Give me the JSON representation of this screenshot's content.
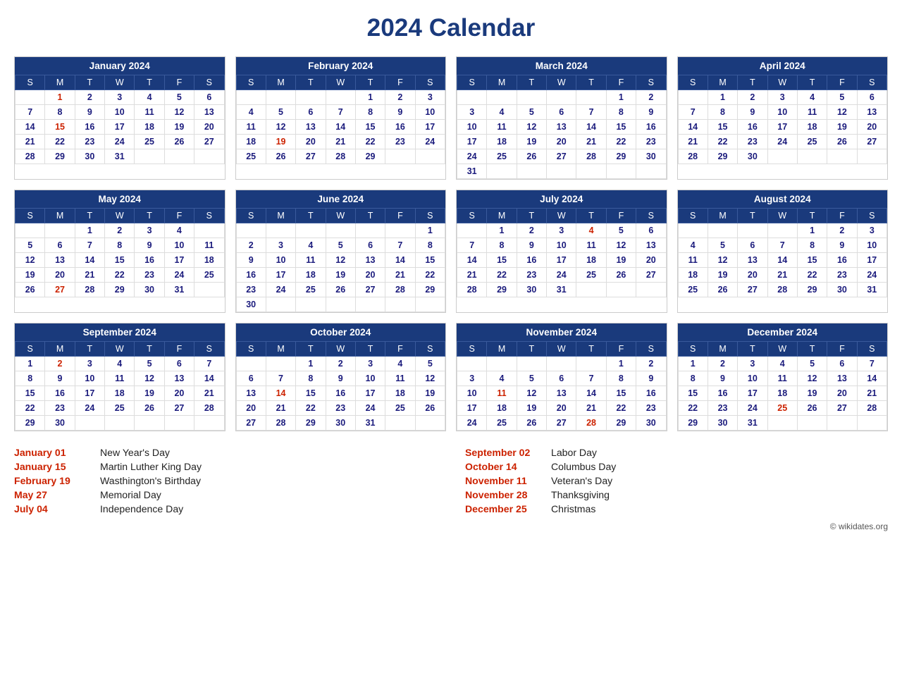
{
  "title": "2024 Calendar",
  "months": [
    {
      "name": "January 2024",
      "days_header": [
        "S",
        "M",
        "T",
        "W",
        "T",
        "F",
        "S"
      ],
      "weeks": [
        [
          "",
          "1h",
          "2",
          "3",
          "4",
          "5",
          "6"
        ],
        [
          "7",
          "8",
          "9",
          "10",
          "11",
          "12",
          "13"
        ],
        [
          "14",
          "15h",
          "16",
          "17",
          "18",
          "19",
          "20"
        ],
        [
          "21",
          "22",
          "23",
          "24",
          "25",
          "26",
          "27"
        ],
        [
          "28",
          "29",
          "30",
          "31",
          "",
          "",
          ""
        ]
      ]
    },
    {
      "name": "February 2024",
      "days_header": [
        "S",
        "M",
        "T",
        "W",
        "T",
        "F",
        "S"
      ],
      "weeks": [
        [
          "",
          "",
          "",
          "",
          "1",
          "2",
          "3"
        ],
        [
          "4",
          "5",
          "6",
          "7",
          "8",
          "9",
          "10"
        ],
        [
          "11",
          "12",
          "13",
          "14",
          "15",
          "16",
          "17"
        ],
        [
          "18",
          "19h",
          "20",
          "21",
          "22",
          "23",
          "24"
        ],
        [
          "25",
          "26",
          "27",
          "28",
          "29",
          "",
          ""
        ]
      ]
    },
    {
      "name": "March 2024",
      "days_header": [
        "S",
        "M",
        "T",
        "W",
        "T",
        "F",
        "S"
      ],
      "weeks": [
        [
          "",
          "",
          "",
          "",
          "",
          "1",
          "2"
        ],
        [
          "3",
          "4",
          "5",
          "6",
          "7",
          "8",
          "9"
        ],
        [
          "10",
          "11",
          "12",
          "13",
          "14",
          "15",
          "16"
        ],
        [
          "17",
          "18",
          "19",
          "20",
          "21",
          "22",
          "23"
        ],
        [
          "24",
          "25",
          "26",
          "27",
          "28",
          "29",
          "30"
        ],
        [
          "31",
          "",
          "",
          "",
          "",
          "",
          ""
        ]
      ]
    },
    {
      "name": "April 2024",
      "days_header": [
        "S",
        "M",
        "T",
        "W",
        "T",
        "F",
        "S"
      ],
      "weeks": [
        [
          "",
          "1",
          "2",
          "3",
          "4",
          "5",
          "6"
        ],
        [
          "7",
          "8",
          "9",
          "10",
          "11",
          "12",
          "13"
        ],
        [
          "14",
          "15",
          "16",
          "17",
          "18",
          "19",
          "20"
        ],
        [
          "21",
          "22",
          "23",
          "24",
          "25",
          "26",
          "27"
        ],
        [
          "28",
          "29",
          "30",
          "",
          "",
          "",
          ""
        ]
      ]
    },
    {
      "name": "May 2024",
      "days_header": [
        "S",
        "M",
        "T",
        "W",
        "T",
        "F",
        "S"
      ],
      "weeks": [
        [
          "",
          "",
          "1",
          "2",
          "3",
          "4",
          ""
        ],
        [
          "5",
          "6",
          "7",
          "8",
          "9",
          "10",
          "11"
        ],
        [
          "12",
          "13",
          "14",
          "15",
          "16",
          "17",
          "18"
        ],
        [
          "19",
          "20",
          "21",
          "22",
          "23",
          "24",
          "25"
        ],
        [
          "26",
          "27h",
          "28",
          "29",
          "30",
          "31",
          ""
        ]
      ]
    },
    {
      "name": "June 2024",
      "days_header": [
        "S",
        "M",
        "T",
        "W",
        "T",
        "F",
        "S"
      ],
      "weeks": [
        [
          "",
          "",
          "",
          "",
          "",
          "",
          "1"
        ],
        [
          "2",
          "3",
          "4",
          "5",
          "6",
          "7",
          "8"
        ],
        [
          "9",
          "10",
          "11",
          "12",
          "13",
          "14",
          "15"
        ],
        [
          "16",
          "17",
          "18",
          "19",
          "20",
          "21",
          "22"
        ],
        [
          "23",
          "24",
          "25",
          "26",
          "27",
          "28",
          "29"
        ],
        [
          "30",
          "",
          "",
          "",
          "",
          "",
          ""
        ]
      ]
    },
    {
      "name": "July 2024",
      "days_header": [
        "S",
        "M",
        "T",
        "W",
        "T",
        "F",
        "S"
      ],
      "weeks": [
        [
          "",
          "1",
          "2",
          "3",
          "4h",
          "5",
          "6"
        ],
        [
          "7",
          "8",
          "9",
          "10",
          "11",
          "12",
          "13"
        ],
        [
          "14",
          "15",
          "16",
          "17",
          "18",
          "19",
          "20"
        ],
        [
          "21",
          "22",
          "23",
          "24",
          "25",
          "26",
          "27"
        ],
        [
          "28",
          "29",
          "30",
          "31",
          "",
          "",
          ""
        ]
      ]
    },
    {
      "name": "August 2024",
      "days_header": [
        "S",
        "M",
        "T",
        "W",
        "T",
        "F",
        "S"
      ],
      "weeks": [
        [
          "",
          "",
          "",
          "",
          "1",
          "2",
          "3"
        ],
        [
          "4",
          "5",
          "6",
          "7",
          "8",
          "9",
          "10"
        ],
        [
          "11",
          "12",
          "13",
          "14",
          "15",
          "16",
          "17"
        ],
        [
          "18",
          "19",
          "20",
          "21",
          "22",
          "23",
          "24"
        ],
        [
          "25",
          "26",
          "27",
          "28",
          "29",
          "30",
          "31"
        ]
      ]
    },
    {
      "name": "September 2024",
      "days_header": [
        "S",
        "M",
        "T",
        "W",
        "T",
        "F",
        "S"
      ],
      "weeks": [
        [
          "1",
          "2h",
          "3",
          "4",
          "5",
          "6",
          "7"
        ],
        [
          "8",
          "9",
          "10",
          "11",
          "12",
          "13",
          "14"
        ],
        [
          "15",
          "16",
          "17",
          "18",
          "19",
          "20",
          "21"
        ],
        [
          "22",
          "23",
          "24",
          "25",
          "26",
          "27",
          "28"
        ],
        [
          "29",
          "30",
          "",
          "",
          "",
          "",
          ""
        ]
      ]
    },
    {
      "name": "October 2024",
      "days_header": [
        "S",
        "M",
        "T",
        "W",
        "T",
        "F",
        "S"
      ],
      "weeks": [
        [
          "",
          "",
          "1",
          "2",
          "3",
          "4",
          "5"
        ],
        [
          "6",
          "7",
          "8",
          "9",
          "10",
          "11",
          "12"
        ],
        [
          "13",
          "14h",
          "15",
          "16",
          "17",
          "18",
          "19"
        ],
        [
          "20",
          "21",
          "22",
          "23",
          "24",
          "25",
          "26"
        ],
        [
          "27",
          "28",
          "29",
          "30",
          "31",
          "",
          ""
        ]
      ]
    },
    {
      "name": "November 2024",
      "days_header": [
        "S",
        "M",
        "T",
        "W",
        "T",
        "F",
        "S"
      ],
      "weeks": [
        [
          "",
          "",
          "",
          "",
          "",
          "1",
          "2"
        ],
        [
          "3",
          "4",
          "5",
          "6",
          "7",
          "8",
          "9"
        ],
        [
          "10",
          "11h",
          "12",
          "13",
          "14",
          "15",
          "16"
        ],
        [
          "17",
          "18",
          "19",
          "20",
          "21",
          "22",
          "23"
        ],
        [
          "24",
          "25",
          "26",
          "27",
          "28h",
          "29",
          "30"
        ]
      ]
    },
    {
      "name": "December 2024",
      "days_header": [
        "S",
        "M",
        "T",
        "W",
        "T",
        "F",
        "S"
      ],
      "weeks": [
        [
          "1",
          "2",
          "3",
          "4",
          "5",
          "6",
          "7"
        ],
        [
          "8",
          "9",
          "10",
          "11",
          "12",
          "13",
          "14"
        ],
        [
          "15",
          "16",
          "17",
          "18",
          "19",
          "20",
          "21"
        ],
        [
          "22",
          "23",
          "24",
          "25h",
          "26",
          "27",
          "28"
        ],
        [
          "29",
          "30",
          "31",
          "",
          "",
          "",
          ""
        ]
      ]
    }
  ],
  "holidays_left": [
    {
      "date": "January 01",
      "name": "New Year's Day"
    },
    {
      "date": "January 15",
      "name": "Martin Luther King Day"
    },
    {
      "date": "February 19",
      "name": "Wasthington's Birthday"
    },
    {
      "date": "May 27",
      "name": "Memorial Day"
    },
    {
      "date": "July 04",
      "name": "Independence Day"
    }
  ],
  "holidays_right": [
    {
      "date": "September 02",
      "name": "Labor Day"
    },
    {
      "date": "October 14",
      "name": "Columbus Day"
    },
    {
      "date": "November 11",
      "name": "Veteran's Day"
    },
    {
      "date": "November 28",
      "name": "Thanksgiving"
    },
    {
      "date": "December 25",
      "name": "Christmas"
    }
  ],
  "copyright": "© wikidates.org"
}
